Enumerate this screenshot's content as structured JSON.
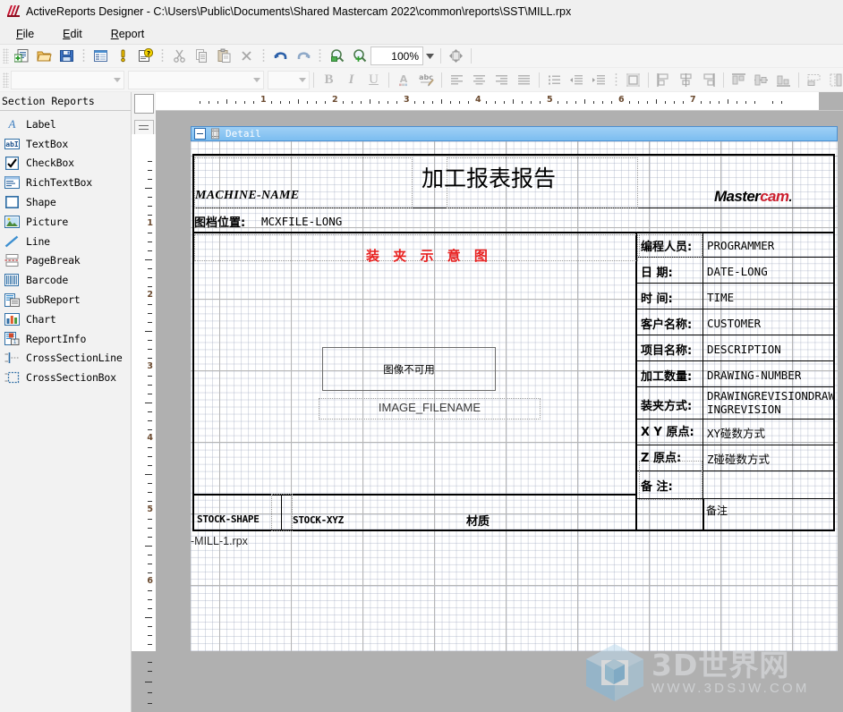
{
  "window": {
    "title": "ActiveReports Designer - C:\\Users\\Public\\Documents\\Shared Mastercam 2022\\common\\reports\\SST\\MILL.rpx",
    "icon": "activereports-icon"
  },
  "menu": {
    "items": [
      {
        "label": "File",
        "accel": "F"
      },
      {
        "label": "Edit",
        "accel": "E"
      },
      {
        "label": "Report",
        "accel": "R"
      }
    ]
  },
  "toolbar": {
    "row1": [
      {
        "name": "new-report-button",
        "icon": "new-report-icon"
      },
      {
        "name": "open-button",
        "icon": "open-folder-icon"
      },
      {
        "name": "save-button",
        "icon": "save-disk-icon"
      },
      {
        "name": "properties-button",
        "icon": "properties-icon"
      },
      {
        "name": "script-button",
        "icon": "exclamation-icon"
      },
      {
        "name": "help-button",
        "icon": "help-question-icon"
      },
      {
        "name": "cut-button",
        "icon": "scissors-icon"
      },
      {
        "name": "copy-button",
        "icon": "copy-icon"
      },
      {
        "name": "paste-button",
        "icon": "paste-icon"
      },
      {
        "name": "delete-button",
        "icon": "close-x-icon"
      },
      {
        "name": "undo-button",
        "icon": "undo-arrow-icon"
      },
      {
        "name": "redo-button",
        "icon": "redo-arrow-icon"
      },
      {
        "name": "zoom-out-button",
        "icon": "magnifier-minus-icon"
      },
      {
        "name": "zoom-in-button",
        "icon": "magnifier-plus-icon"
      }
    ],
    "zoom_value": "100%",
    "fit-button": {
      "name": "fit-to-window-button",
      "icon": "fit-window-icon"
    },
    "font_name": "",
    "font_name_placeholder": "",
    "font_style": "",
    "font_size": "",
    "format_buttons": [
      {
        "name": "bold-button",
        "label": "B"
      },
      {
        "name": "italic-button",
        "label": "I"
      },
      {
        "name": "underline-button",
        "label": "U"
      },
      {
        "name": "font-color-button",
        "icon": "font-color-icon"
      },
      {
        "name": "spelling-button",
        "icon": "spell-check-icon"
      }
    ],
    "align_buttons": [
      {
        "name": "align-left-button",
        "icon": "align-left-icon"
      },
      {
        "name": "align-center-button",
        "icon": "align-center-icon"
      },
      {
        "name": "align-right-button",
        "icon": "align-right-icon"
      },
      {
        "name": "align-justify-button",
        "icon": "align-justify-icon"
      },
      {
        "name": "bullets-button",
        "icon": "bullet-list-icon"
      },
      {
        "name": "indent-decrease-button",
        "icon": "indent-decrease-icon"
      },
      {
        "name": "indent-increase-button",
        "icon": "indent-increase-icon"
      },
      {
        "name": "size-to-grid-button",
        "icon": "size-to-grid-icon"
      },
      {
        "name": "align-controls-left-button",
        "icon": "align-controls-left-icon"
      },
      {
        "name": "align-controls-center-button",
        "icon": "align-controls-center-icon"
      },
      {
        "name": "align-controls-right-button",
        "icon": "align-controls-right-icon"
      },
      {
        "name": "align-tops-button",
        "icon": "align-tops-icon"
      },
      {
        "name": "align-middles-button",
        "icon": "align-middles-icon"
      },
      {
        "name": "align-bottoms-button",
        "icon": "align-bottoms-icon"
      },
      {
        "name": "make-same-width-button",
        "icon": "same-width-icon"
      },
      {
        "name": "make-same-height-button",
        "icon": "same-height-icon"
      },
      {
        "name": "make-same-size-button",
        "icon": "same-size-icon"
      },
      {
        "name": "center-horizontally-button",
        "icon": "center-horizontally-icon"
      },
      {
        "name": "space-equally-button",
        "icon": "space-equally-icon"
      }
    ]
  },
  "toolbox": {
    "header": "Section Reports",
    "items": [
      {
        "label": "Label",
        "icon": "label-icon"
      },
      {
        "label": "TextBox",
        "icon": "textbox-icon"
      },
      {
        "label": "CheckBox",
        "icon": "checkbox-icon"
      },
      {
        "label": "RichTextBox",
        "icon": "richtextbox-icon"
      },
      {
        "label": "Shape",
        "icon": "shape-icon"
      },
      {
        "label": "Picture",
        "icon": "picture-icon"
      },
      {
        "label": "Line",
        "icon": "line-icon"
      },
      {
        "label": "PageBreak",
        "icon": "pagebreak-icon"
      },
      {
        "label": "Barcode",
        "icon": "barcode-icon"
      },
      {
        "label": "SubReport",
        "icon": "subreport-icon"
      },
      {
        "label": "Chart",
        "icon": "chart-icon"
      },
      {
        "label": "ReportInfo",
        "icon": "reportinfo-icon"
      },
      {
        "label": "CrossSectionLine",
        "icon": "crosssectionline-icon"
      },
      {
        "label": "CrossSectionBox",
        "icon": "crosssectionbox-icon"
      }
    ]
  },
  "rulers": {
    "horizontal_labels": [
      "1",
      "2",
      "3",
      "4",
      "5",
      "6",
      "7"
    ],
    "vertical_labels": [
      "1",
      "2",
      "3",
      "4",
      "5",
      "6"
    ]
  },
  "band": {
    "name": "Detail",
    "collapse_icon": "collapse-minus-icon",
    "band_icon": "detail-band-icon"
  },
  "report": {
    "title": "加工报表报告",
    "machine_name": "MACHINE-NAME",
    "file_label": "图档位置:",
    "file_value": "MCXFILE-LONG",
    "logo": {
      "part1": "Master",
      "part2": "cam",
      "dot": "."
    },
    "diagram_title": "装 夹 示 意 图",
    "image_placeholder": "图像不可用",
    "image_filename": "IMAGE_FILENAME",
    "info_rows": [
      {
        "label": "编程人员:",
        "value": "PROGRAMMER"
      },
      {
        "label": "日      期:",
        "value": "DATE-LONG"
      },
      {
        "label": "时      间:",
        "value": "TIME"
      },
      {
        "label": "客户名称:",
        "value": "CUSTOMER"
      },
      {
        "label": "项目名称:",
        "value": "DESCRIPTION"
      },
      {
        "label": "加工数量:",
        "value": "DRAWING-NUMBER"
      },
      {
        "label": "装夹方式:",
        "value": "DRAWINGREVISIONDRAWINGREVISION"
      },
      {
        "label": "X Y 原点:",
        "value": "XY碰数方式"
      },
      {
        "label": "Z    原点:",
        "value": "Z碰碰数方式"
      },
      {
        "label": "备      注:",
        "value": ""
      }
    ],
    "stock_shape": "STOCK-SHAPE",
    "stock_xyz": "STOCK-XYZ",
    "material_label": "材质",
    "remark_label": "备注",
    "footer_file": "-MILL-1.rpx"
  },
  "watermark": {
    "title": "3D世界网",
    "url": "WWW.3DSJW.COM",
    "icon": "cube-logo-icon"
  },
  "colors": {
    "band_blue": "#7cbdf0",
    "accent_red": "#e8201f",
    "logo_red": "#cc1f2e",
    "canvas_bg": "#b0b0b0",
    "ruler_num": "#6b4a2f"
  }
}
